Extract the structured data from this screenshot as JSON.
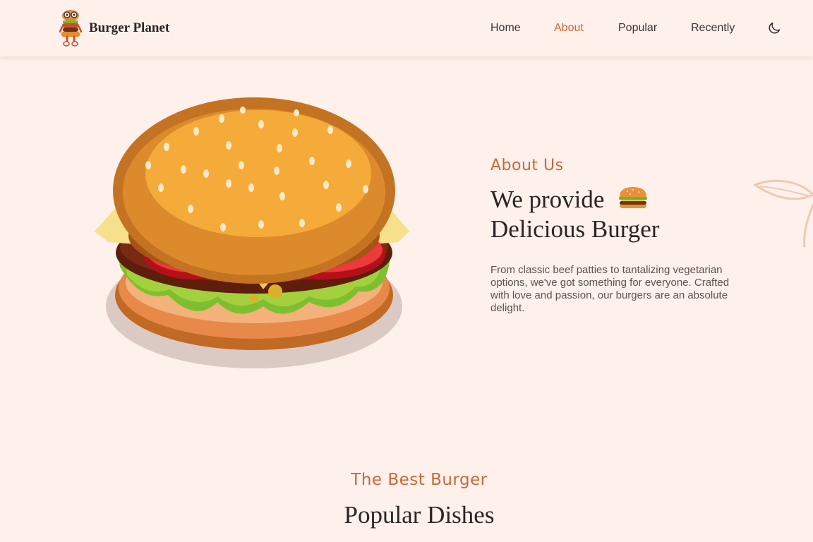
{
  "header": {
    "brand": "Burger Planet",
    "nav": [
      {
        "label": "Home",
        "active": false
      },
      {
        "label": "About",
        "active": true
      },
      {
        "label": "Popular",
        "active": false
      },
      {
        "label": "Recently",
        "active": false
      }
    ],
    "theme_toggle_icon": "moon-icon"
  },
  "about": {
    "subtitle": "About Us",
    "title_line1": "We provide",
    "title_line2": "Delicious Burger",
    "title_icon": "burger-icon",
    "description": "From classic beef patties to tantalizing vegetarian options, we've got something for everyone. Crafted with love and passion, our burgers are an absolute delight."
  },
  "popular": {
    "subtitle": "The Best Burger",
    "title": "Popular Dishes"
  },
  "colors": {
    "accent": "#c8693a",
    "background": "#fef0eb",
    "text": "#2a2626",
    "muted_text": "#5b5252"
  }
}
